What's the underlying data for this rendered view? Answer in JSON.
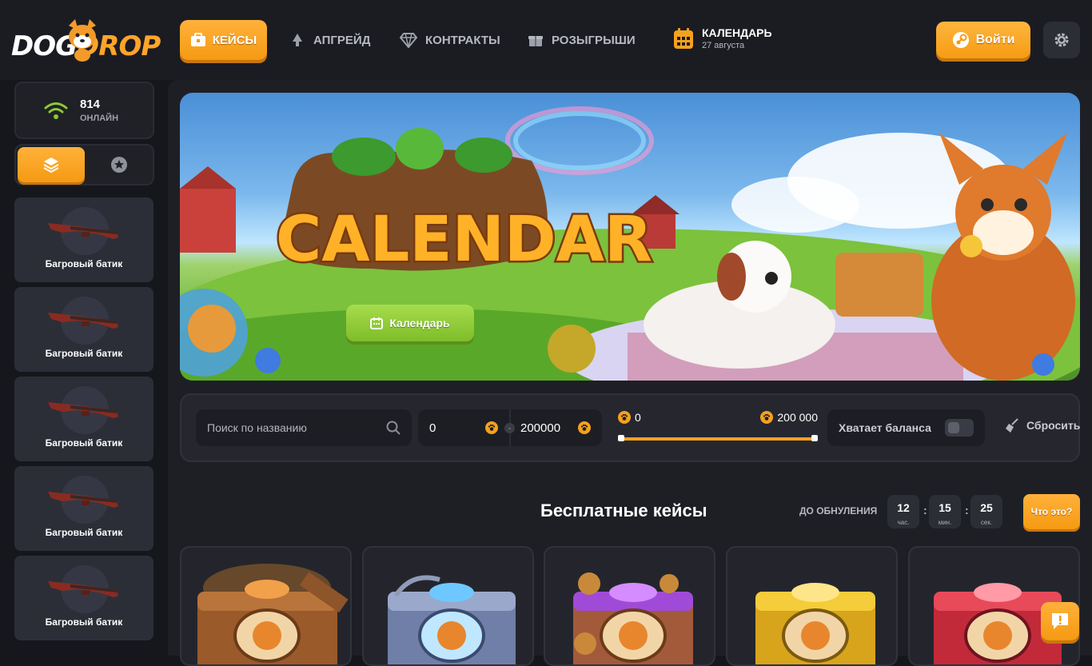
{
  "header": {
    "logo": {
      "part1": "DOG",
      "part2": "DROP"
    },
    "nav": [
      {
        "label": "КЕЙСЫ",
        "icon": "case-icon",
        "active": true
      },
      {
        "label": "АПГРЕЙД",
        "icon": "upgrade-icon"
      },
      {
        "label": "КОНТРАКТЫ",
        "icon": "diamond-icon"
      },
      {
        "label": "РОЗЫГРЫШИ",
        "icon": "giveaway-icon"
      }
    ],
    "calendar": {
      "title": "КАЛЕНДАРЬ",
      "date": "27 августа",
      "icon": "calendar-icon"
    },
    "login_label": "Войти",
    "login_icon": "steam-icon",
    "settings_icon": "gear-icon"
  },
  "sidebar": {
    "online_count": "814",
    "online_label": "ОНЛАЙН",
    "drops": [
      {
        "name": "Багровый батик"
      },
      {
        "name": "Багровый батик"
      },
      {
        "name": "Багровый батик"
      },
      {
        "name": "Багровый батик"
      },
      {
        "name": "Багровый батик"
      }
    ]
  },
  "banner": {
    "title": "CALENDAR",
    "button_label": "Календарь"
  },
  "filters": {
    "search_placeholder": "Поиск по названию",
    "price_min": "0",
    "price_max": "200000",
    "slider_min": "0",
    "slider_max": "200 000",
    "slider_fill_fraction": 1.0,
    "balance_label": "Хватает баланса",
    "reset_label": "Сбросить"
  },
  "free_cases": {
    "title": "Бесплатные кейсы",
    "reset_label": "ДО ОБНУЛЕНИЯ",
    "timer": [
      {
        "value": "12",
        "unit": "час."
      },
      {
        "value": "15",
        "unit": "мин."
      },
      {
        "value": "25",
        "unit": "сек."
      }
    ],
    "what_label": "Что это?"
  },
  "colors": {
    "accent": "#f5a11f",
    "green": "#8cc936",
    "bg": "#16171c"
  }
}
